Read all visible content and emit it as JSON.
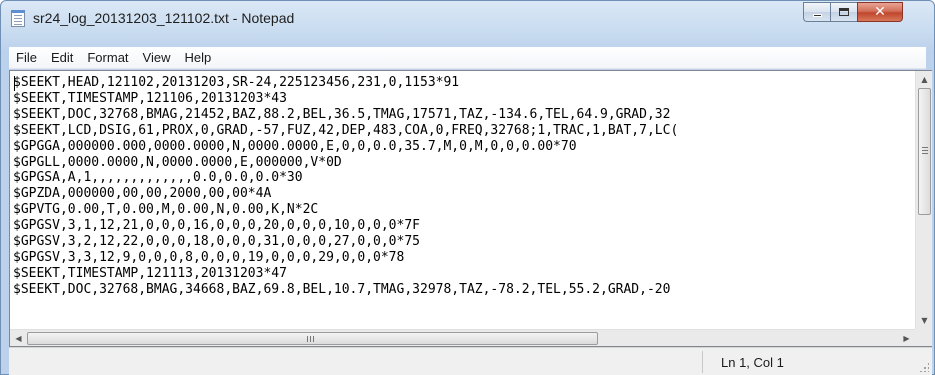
{
  "window": {
    "title": "sr24_log_20131203_121102.txt - Notepad",
    "icon": "notepad-icon"
  },
  "caption": {
    "minimize": "minimize-icon",
    "maximize": "maximize-icon",
    "close_label": "✕"
  },
  "menu": [
    {
      "label": "File"
    },
    {
      "label": "Edit"
    },
    {
      "label": "Format"
    },
    {
      "label": "View"
    },
    {
      "label": "Help"
    }
  ],
  "document": {
    "lines": [
      "$SEEKT,HEAD,121102,20131203,SR-24,225123456,231,0,1153*91",
      "$SEEKT,TIMESTAMP,121106,20131203*43",
      "$SEEKT,DOC,32768,BMAG,21452,BAZ,88.2,BEL,36.5,TMAG,17571,TAZ,-134.6,TEL,64.9,GRAD,32",
      "$SEEKT,LCD,DSIG,61,PROX,0,GRAD,-57,FUZ,42,DEP,483,COA,0,FREQ,32768;1,TRAC,1,BAT,7,LC(",
      "$GPGGA,000000.000,0000.0000,N,0000.0000,E,0,0,0.0,35.7,M,0,M,0,0,0.00*70",
      "$GPGLL,0000.0000,N,0000.0000,E,000000,V*0D",
      "$GPGSA,A,1,,,,,,,,,,,,,0.0,0.0,0.0*30",
      "$GPZDA,000000,00,00,2000,00,00*4A",
      "$GPVTG,0.00,T,0.00,M,0.00,N,0.00,K,N*2C",
      "$GPGSV,3,1,12,21,0,0,0,16,0,0,0,20,0,0,0,10,0,0,0*7F",
      "$GPGSV,3,2,12,22,0,0,0,18,0,0,0,31,0,0,0,27,0,0,0*75",
      "$GPGSV,3,3,12,9,0,0,0,8,0,0,0,19,0,0,0,29,0,0,0*78",
      "$SEEKT,TIMESTAMP,121113,20131203*47",
      "$SEEKT,DOC,32768,BMAG,34668,BAZ,69.8,BEL,10.7,TMAG,32978,TAZ,-78.2,TEL,55.2,GRAD,-20"
    ]
  },
  "scrollbars": {
    "up_arrow": "▲",
    "down_arrow": "▼",
    "left_arrow": "◀",
    "right_arrow": "▶"
  },
  "status": {
    "position": "Ln 1, Col 1"
  }
}
